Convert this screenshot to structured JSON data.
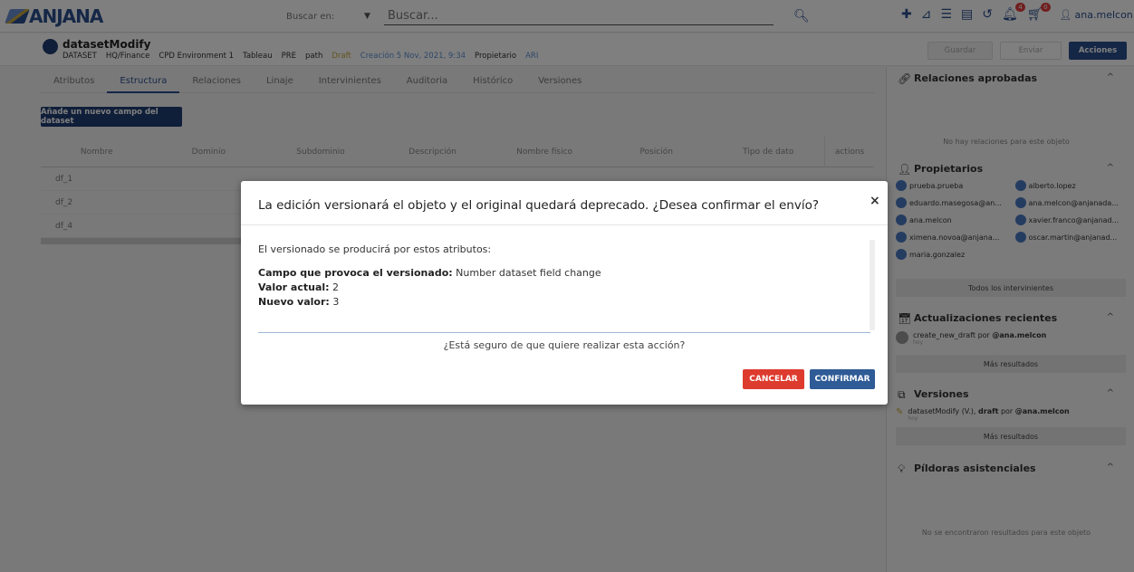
{
  "topbar": {
    "logo": "ANJANA",
    "search_in_label": "Buscar en:",
    "search_placeholder": "Buscar...",
    "badges": {
      "notifications": "4",
      "cart": "0"
    },
    "user": "ana.melcon"
  },
  "object": {
    "title": "datasetModify",
    "meta": [
      "DATASET",
      "HQ/Finance",
      "CPD Environment 1",
      "Tableau",
      "PRE",
      "path",
      "Draft",
      "Creación 5 Nov, 2021, 9:34",
      "Propietario",
      "ARI"
    ],
    "buttons": {
      "guardar": "Guardar",
      "enviar": "Enviar",
      "acciones": "Acciones"
    }
  },
  "tabs": [
    "Atributos",
    "Estructura",
    "Relaciones",
    "Linaje",
    "Intervinientes",
    "Auditoria",
    "Histórico",
    "Versiones"
  ],
  "add_field_button": "Añade un nuevo campo del dataset",
  "table": {
    "headers": [
      "Nombre",
      "Dominio",
      "Subdominio",
      "Descripción",
      "Nombre físico",
      "Posición",
      "Tipo de dato"
    ],
    "actions_header": "actions",
    "rows": [
      "df_1",
      "df_2",
      "df_4"
    ]
  },
  "right_panel": {
    "approved_title": "Relaciones aprobadas",
    "approved_empty": "No hay relaciones para este objeto",
    "owners_title": "Propietarios",
    "owners": [
      "prueba.prueba",
      "alberto.lopez",
      "eduardo.masegosa@an...",
      "ana.melcon@anjanada...",
      "ana.melcon",
      "xavier.franco@anjanad...",
      "ximena.novoa@anjana...",
      "oscar.martin@anjanad...",
      "maria.gonzalez"
    ],
    "all_participants": "Todos los intervinientes",
    "updates_title": "Actualizaciones recientes",
    "update_item": {
      "action": "create_new_draft",
      "por": "por",
      "user": "@ana.melcon",
      "when": "hoy"
    },
    "more_results": "Más resultados",
    "versions_title": "Versiones",
    "version_item": {
      "name": "datasetModify (V.)",
      "state": "draft",
      "por": "por",
      "user": "@ana.melcon",
      "when": "hoy"
    },
    "more_results_2": "Más resultados",
    "pills_title": "Píldoras asistenciales",
    "pills_empty": "No se encontraron resultados para este objeto"
  },
  "modal": {
    "title": "La edición versionará el objeto y el original quedará deprecado. ¿Desea confirmar el envío?",
    "intro": "El versionado se producirá por estos atributos:",
    "field_label": "Campo que provoca el versionado:",
    "field_value": "Number dataset field change",
    "current_label": "Valor actual:",
    "current_value": "2",
    "new_label": "Nuevo valor:",
    "new_value": "3",
    "question": "¿Está seguro de que quiere realizar esta acción?",
    "cancel": "CANCELAR",
    "confirm": "CONFIRMAR"
  }
}
